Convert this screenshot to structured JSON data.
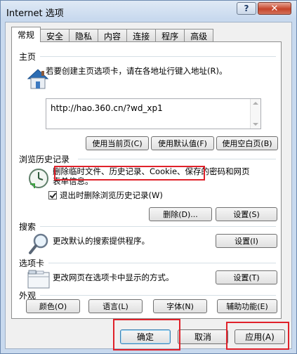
{
  "window": {
    "title": "Internet 选项",
    "help_label": "?",
    "close_label": "✕"
  },
  "tabs": [
    "常规",
    "安全",
    "隐私",
    "内容",
    "连接",
    "程序",
    "高级"
  ],
  "home": {
    "section": "主页",
    "desc": "若要创建主页选项卡，请在各地址行键入地址(R)。",
    "url": "http://hao.360.cn/?wd_xp1",
    "buttons": [
      "使用当前页(C)",
      "使用默认值(F)",
      "使用空白页(B)"
    ]
  },
  "history": {
    "section": "浏览历史记录",
    "desc_line1": "删除临时文件、历史记录、Cookie、保存的密码和网页",
    "desc_line2": "表单信息。",
    "checkbox_label": "退出时删除浏览历史记录(W)",
    "checkbox_checked": true,
    "delete_btn": "删除(D)...",
    "settings_btn": "设置(S)"
  },
  "search": {
    "section": "搜索",
    "desc": "更改默认的搜索提供程序。",
    "settings_btn": "设置(I)"
  },
  "tabs_section": {
    "section": "选项卡",
    "desc": "更改网页在选项卡中显示的方式。",
    "settings_btn": "设置(T)"
  },
  "appearance": {
    "section": "外观",
    "buttons": [
      "颜色(O)",
      "语言(L)",
      "字体(N)",
      "辅助功能(E)"
    ]
  },
  "footer": {
    "ok": "确定",
    "cancel": "取消",
    "apply": "应用(A)"
  },
  "colors": {
    "highlight": "#e0212a",
    "title_bg": "#c8d9ee"
  }
}
